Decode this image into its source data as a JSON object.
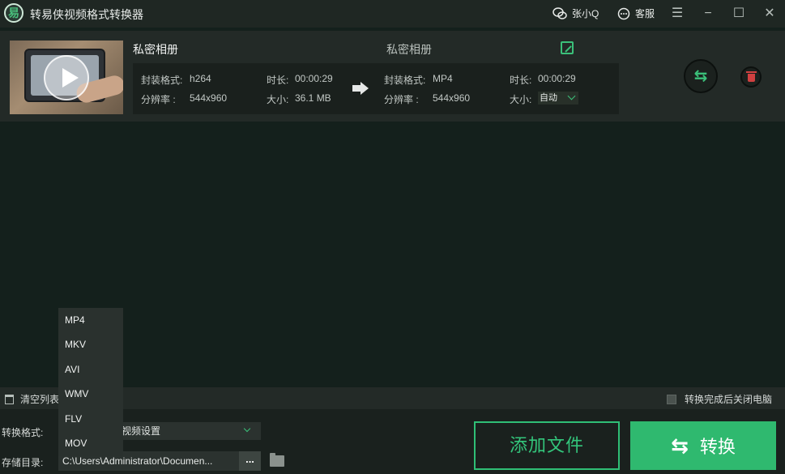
{
  "app": {
    "title": "转易侠视频格式转换器",
    "logo_glyph": "易"
  },
  "titlebar": {
    "user": "张小Q",
    "service": "客服"
  },
  "file": {
    "name": "私密相册",
    "output_name": "私密相册",
    "source": {
      "format_label": "封装格式:",
      "format": "h264",
      "duration_label": "时长:",
      "duration": "00:00:29",
      "resolution_label": "分辨率  :",
      "resolution": "544x960",
      "size_label": "大小:",
      "size": "36.1 MB"
    },
    "target": {
      "format_label": "封装格式:",
      "format": "MP4",
      "duration_label": "时长:",
      "duration": "00:00:29",
      "resolution_label": "分辨率  :",
      "resolution": "544x960",
      "size_label": "大小:",
      "size": "自动"
    }
  },
  "toolbar": {
    "clear_list": "清空列表",
    "shutdown_label": "转换完成后关闭电脑"
  },
  "bottom": {
    "format_label": "转换格式:",
    "format_value": "视频设置",
    "dir_label": "存储目录:",
    "dir_value": "C:\\Users\\Administrator\\Documen...",
    "browse_label": "...",
    "add_files": "添加文件",
    "convert": "转换"
  },
  "dropdown": {
    "options": [
      "MP4",
      "MKV",
      "AVI",
      "WMV",
      "FLV",
      "MOV"
    ]
  },
  "colors": {
    "accent": "#2fb96f",
    "background": "#14201c",
    "delete": "#d04040"
  }
}
